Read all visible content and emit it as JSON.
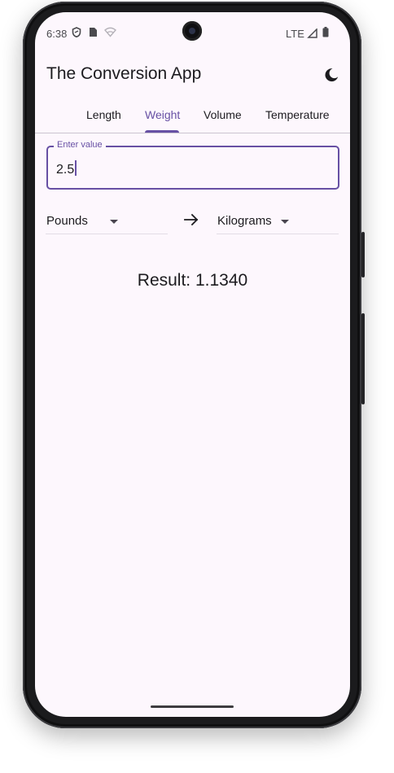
{
  "status_bar": {
    "time": "6:38",
    "network": "LTE",
    "icons": [
      "shield-icon",
      "sim-card-icon",
      "wifi-off-icon",
      "signal-icon",
      "battery-icon"
    ]
  },
  "app": {
    "title": "The Conversion App",
    "theme_toggle_icon": "moon-icon",
    "accent_color": "#6750a4"
  },
  "tabs": [
    {
      "label": "Length",
      "active": false
    },
    {
      "label": "Weight",
      "active": true
    },
    {
      "label": "Volume",
      "active": false
    },
    {
      "label": "Temperature",
      "active": false
    }
  ],
  "input": {
    "label": "Enter value",
    "value": "2.5"
  },
  "conversion": {
    "from_unit": "Pounds",
    "to_unit": "Kilograms",
    "arrow_icon": "arrow-right-icon"
  },
  "result": {
    "text": "Result: 1.1340"
  }
}
